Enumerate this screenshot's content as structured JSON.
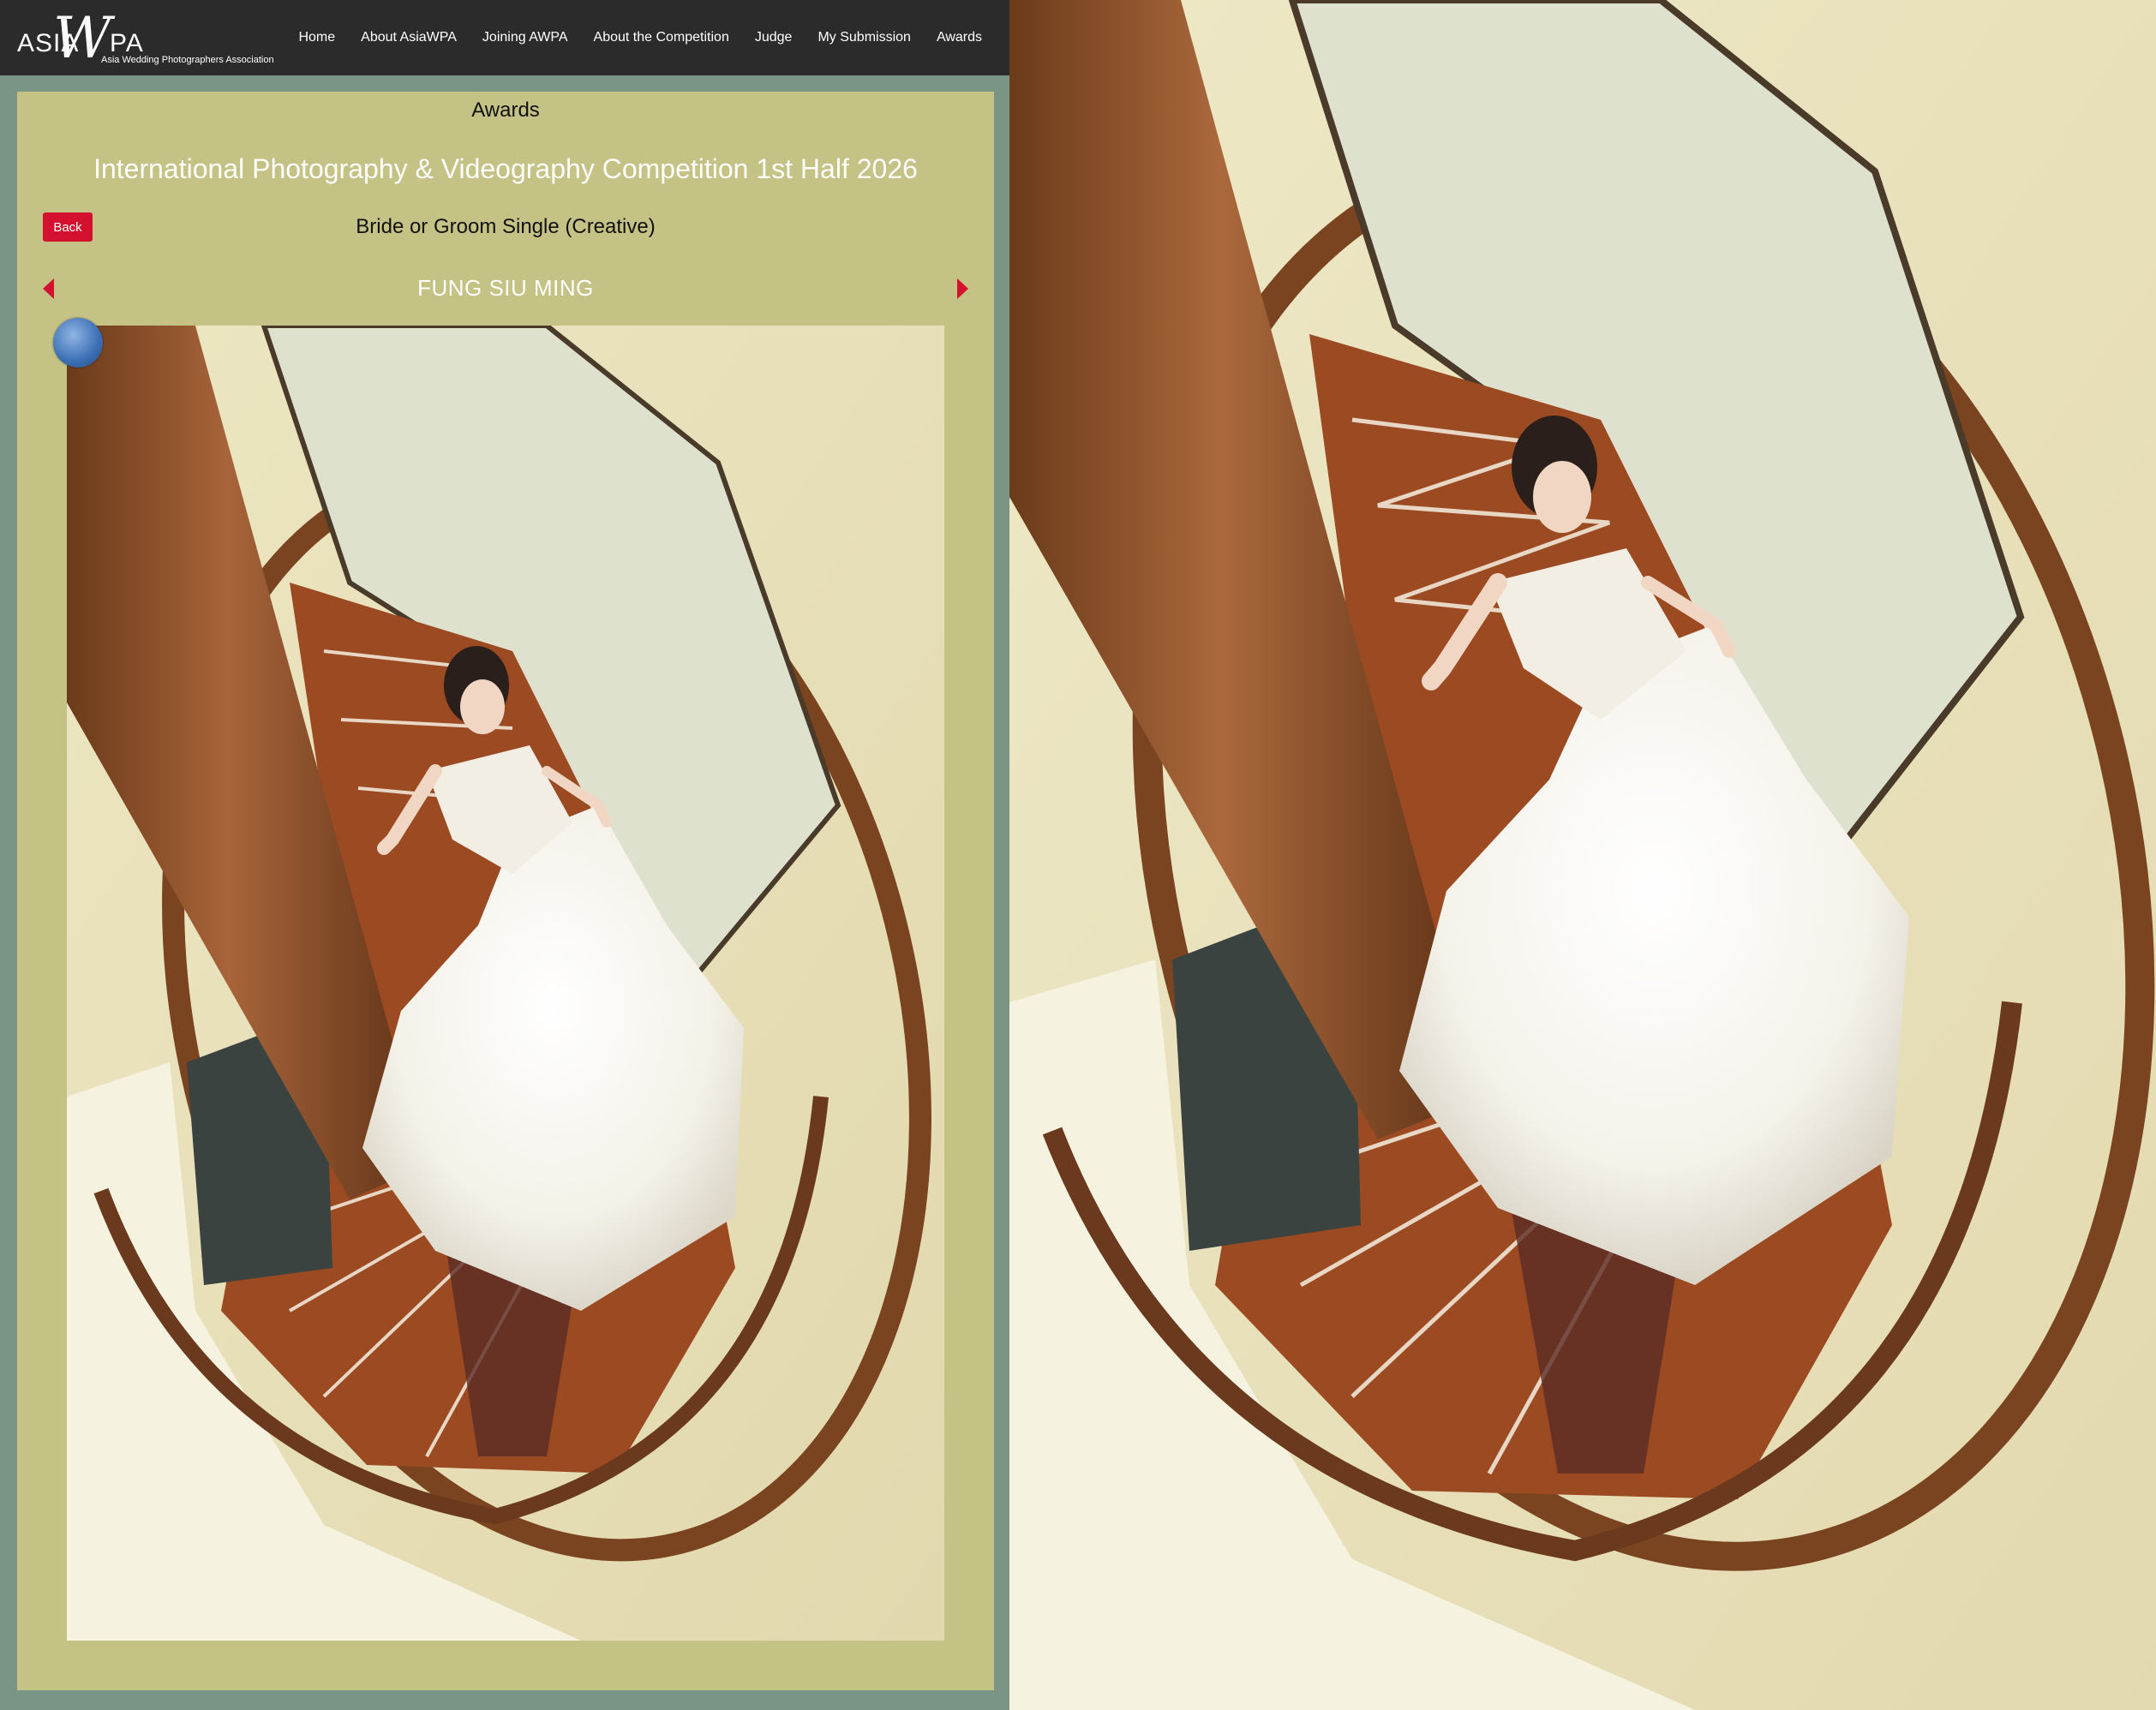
{
  "logo": {
    "asia": "ASIA",
    "w": "W",
    "pa": "PA",
    "subtitle": "Asia Wedding Photographers Association"
  },
  "nav": {
    "items": [
      "Home",
      "About AsiaWPA",
      "Joining AWPA",
      "About the Competition",
      "Judge",
      "My Submission",
      "Awards"
    ]
  },
  "page": {
    "heading": "Awards",
    "competition_title": "International Photography & Videography Competition 1st Half 2026",
    "back_label": "Back",
    "category": "Bride or Groom Single (Creative)",
    "photographer": "FUNG SIU MING"
  },
  "colors": {
    "navbar": "#2b2b2b",
    "panel": "#c5c285",
    "page_bg": "#7a9486",
    "accent_red": "#d4112e"
  },
  "icons": {
    "prev": "arrow-left-icon",
    "next": "arrow-right-icon",
    "award": "award-badge-icon"
  }
}
